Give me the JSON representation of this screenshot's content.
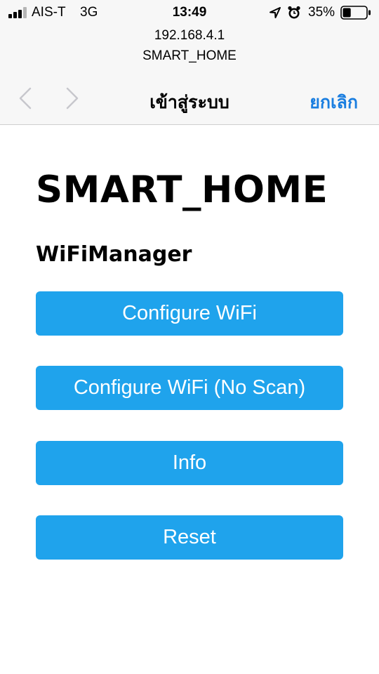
{
  "status_bar": {
    "carrier": "AIS-T",
    "network": "3G",
    "time": "13:49",
    "battery_percent": "35%",
    "battery_level": 0.35,
    "signal_bars_filled": 3,
    "signal_bars_total": 4,
    "icons": [
      "signal-icon",
      "location-arrow-icon",
      "alarm-clock-icon",
      "battery-icon"
    ]
  },
  "browser": {
    "url": "192.168.4.1",
    "site_title": "SMART_HOME",
    "nav_title": "เข้าสู่ระบบ",
    "cancel_label": "ยกเลิก",
    "back_icon": "chevron-left-icon",
    "forward_icon": "chevron-right-icon"
  },
  "page": {
    "title": "SMART_HOME",
    "subtitle": "WiFiManager",
    "buttons": [
      {
        "label": "Configure WiFi"
      },
      {
        "label": "Configure WiFi (No Scan)"
      },
      {
        "label": "Info"
      },
      {
        "label": "Reset"
      }
    ]
  },
  "colors": {
    "button_background": "#1fa3ec",
    "button_text": "#ffffff",
    "link_blue": "#1a7ee0",
    "bar_background": "#f7f7f7"
  }
}
